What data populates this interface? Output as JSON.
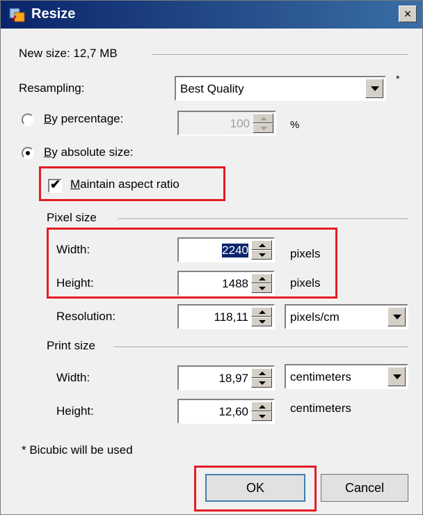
{
  "window": {
    "title": "Resize",
    "close_label": "×"
  },
  "new_size": {
    "label": "New size: 12,7 MB"
  },
  "resampling": {
    "label": "Resampling:",
    "value": "Best Quality",
    "asterisk": "*"
  },
  "by_percentage": {
    "label_u": "B",
    "label_rest": "y percentage:",
    "value": "100",
    "unit": "%",
    "selected": false
  },
  "by_absolute": {
    "label_u": "B",
    "label_rest": "y absolute size:",
    "selected": true
  },
  "maintain_aspect": {
    "label_u": "M",
    "label_rest": "aintain aspect ratio",
    "checked": true,
    "check": "✔"
  },
  "pixel_size": {
    "group_label": "Pixel size",
    "width_label": "Width:",
    "width_value": "2240",
    "width_unit": "pixels",
    "height_label": "Height:",
    "height_value": "1488",
    "height_unit": "pixels",
    "resolution_label": "Resolution:",
    "resolution_value": "118,11",
    "resolution_unit": "pixels/cm"
  },
  "print_size": {
    "group_label": "Print size",
    "width_label": "Width:",
    "width_value": "18,97",
    "width_unit": "centimeters",
    "height_label": "Height:",
    "height_value": "12,60",
    "height_unit": "centimeters"
  },
  "footnote": "* Bicubic will be used",
  "buttons": {
    "ok": "OK",
    "cancel": "Cancel"
  },
  "colors": {
    "highlight": "#e51c23",
    "titlebar": "#0a246a",
    "selection": "#0a246a"
  }
}
